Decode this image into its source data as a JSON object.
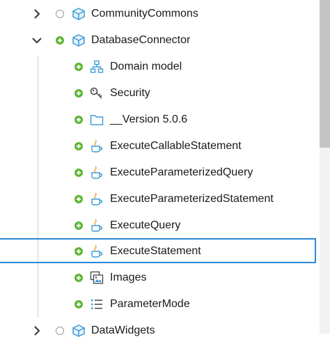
{
  "tree": {
    "modules": [
      {
        "label": "CommunityCommons",
        "expanded": false,
        "status": "none"
      },
      {
        "label": "DatabaseConnector",
        "expanded": true,
        "status": "added"
      },
      {
        "label": "DataWidgets",
        "expanded": false,
        "status": "none"
      }
    ],
    "children": [
      {
        "label": "Domain model",
        "icon": "domain-model-icon"
      },
      {
        "label": "Security",
        "icon": "key-icon"
      },
      {
        "label": "__Version 5.0.6",
        "icon": "folder-icon"
      },
      {
        "label": "ExecuteCallableStatement",
        "icon": "java-action-icon"
      },
      {
        "label": "ExecuteParameterizedQuery",
        "icon": "java-action-icon"
      },
      {
        "label": "ExecuteParameterizedStatement",
        "icon": "java-action-icon"
      },
      {
        "label": "ExecuteQuery",
        "icon": "java-action-icon"
      },
      {
        "label": "ExecuteStatement",
        "icon": "java-action-icon",
        "selected": true
      },
      {
        "label": "Images",
        "icon": "images-icon"
      },
      {
        "label": "ParameterMode",
        "icon": "enumeration-icon"
      }
    ]
  },
  "colors": {
    "selection": "#2b88d8",
    "added": "#5fb634",
    "module_icon": "#3b9bd8",
    "java_cup": "#3b9bd8",
    "java_steam": "#f0a030"
  }
}
